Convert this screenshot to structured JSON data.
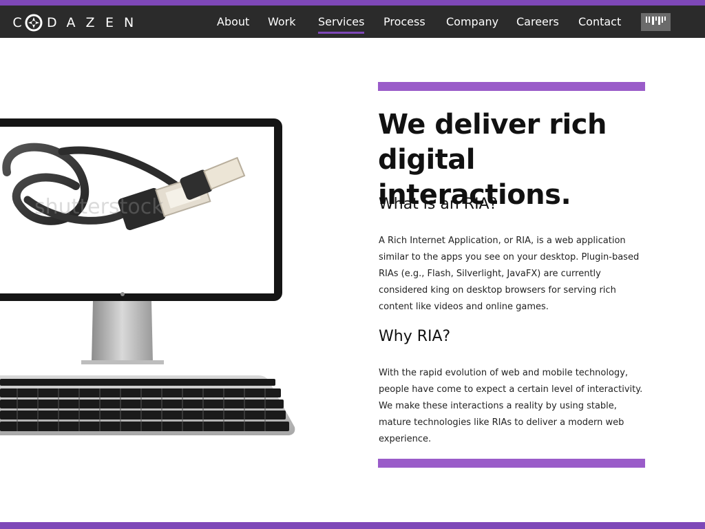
{
  "brand": {
    "letters_before": [
      "C"
    ],
    "letters_after": [
      "D",
      "A",
      "Z",
      "E",
      "N"
    ],
    "logo_icon": "compass-logo-icon"
  },
  "nav": {
    "items": [
      {
        "label": "About",
        "active": false
      },
      {
        "label": "Work",
        "active": false
      },
      {
        "label": "Services",
        "active": true
      },
      {
        "label": "Process",
        "active": false
      },
      {
        "label": "Company",
        "active": false
      },
      {
        "label": "Careers",
        "active": false
      },
      {
        "label": "Contact",
        "active": false
      }
    ],
    "menu_icon": "barcode-menu-icon"
  },
  "hero": {
    "image_alt": "Computer monitor and keyboard with USB cable on screen",
    "watermark": "shutterstock"
  },
  "main": {
    "headline_line1": "We deliver rich",
    "headline_line2": "digital interactions.",
    "section1_title": "What is an RIA?",
    "section1_body": "A Rich Internet Application, or RIA, is a web application similar to the apps you see on your desktop. Plugin-based RIAs (e.g., Flash, Silverlight, JavaFX) are currently considered king on desktop browsers for serving rich content like videos and online games.",
    "section2_title": "Why RIA?",
    "section2_body": "With the rapid evolution of web and mobile technology, people have come to expect a certain level of interactivity. We make these interactions a reality by using stable, mature technologies like RIAs to deliver a modern web experience."
  },
  "colors": {
    "accent": "#7e48b8",
    "accent_bar": "#9a5cc9",
    "navbar_bg": "#2b2b2b",
    "menu_button_bg": "#6b6b6b"
  }
}
